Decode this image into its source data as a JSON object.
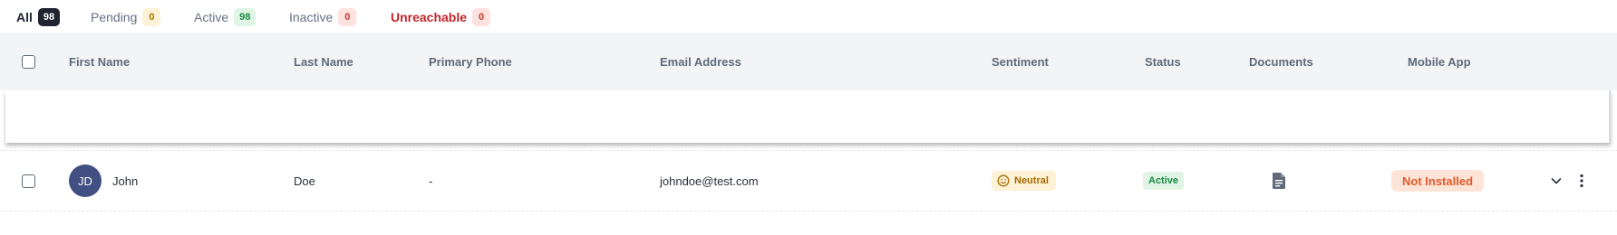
{
  "tabs": [
    {
      "label": "All",
      "count": "98"
    },
    {
      "label": "Pending",
      "count": "0"
    },
    {
      "label": "Active",
      "count": "98"
    },
    {
      "label": "Inactive",
      "count": "0"
    },
    {
      "label": "Unreachable",
      "count": "0"
    }
  ],
  "columns": {
    "first_name": "First Name",
    "last_name": "Last Name",
    "primary_phone": "Primary Phone",
    "email": "Email Address",
    "sentiment": "Sentiment",
    "status": "Status",
    "documents": "Documents",
    "mobile_app": "Mobile App"
  },
  "rows": [
    {
      "initials": "JD",
      "first_name": "John",
      "last_name": "Doe",
      "primary_phone": "-",
      "email": "johndoe@test.com",
      "sentiment": "Neutral",
      "status": "Active",
      "documents_icon": "document-icon",
      "mobile_app": "Not Installed"
    }
  ],
  "colors": {
    "avatar": "#414f82",
    "active_tab": "#1f2430",
    "unreachable": "#c2252a",
    "sentiment_neutral": "#a86a00",
    "status_active": "#1c8a43",
    "not_installed": "#e2592a"
  }
}
